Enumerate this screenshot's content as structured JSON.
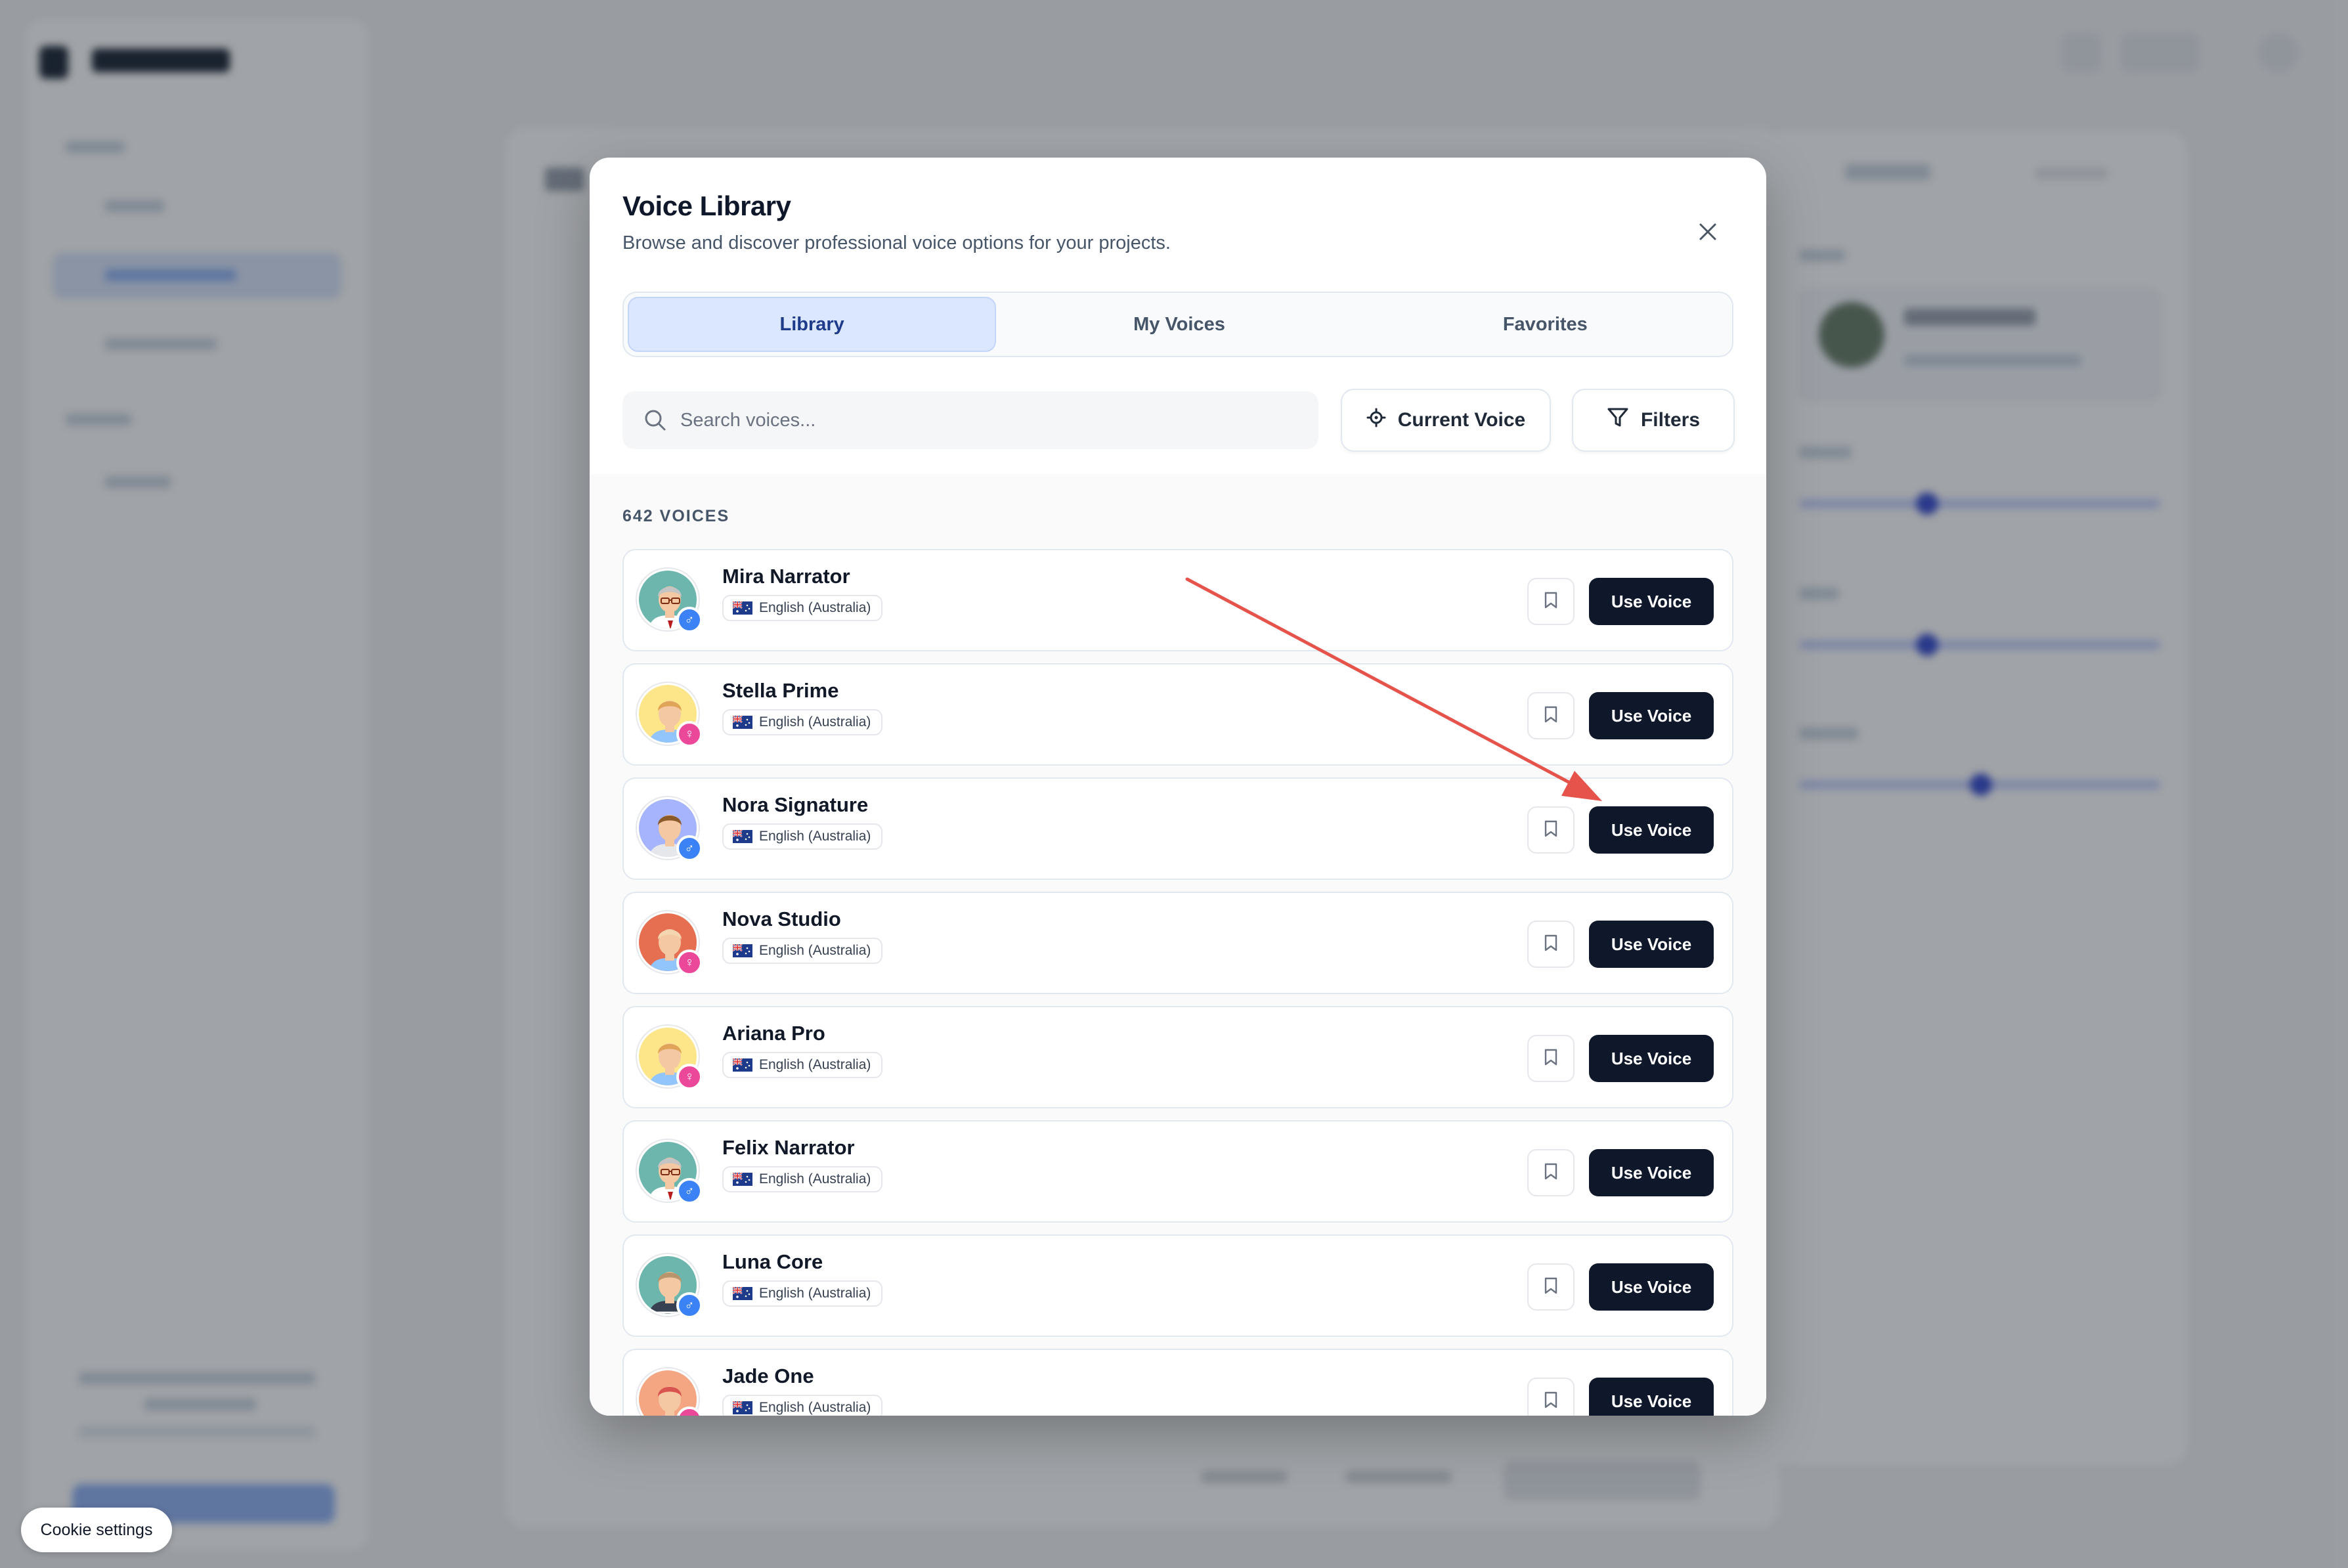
{
  "modal": {
    "title": "Voice Library",
    "subtitle": "Browse and discover professional voice options for your projects."
  },
  "tabs": [
    {
      "label": "Library",
      "active": true
    },
    {
      "label": "My Voices",
      "active": false
    },
    {
      "label": "Favorites",
      "active": false
    }
  ],
  "search": {
    "placeholder": "Search voices...",
    "value": ""
  },
  "toolbar": {
    "current_voice_label": "Current Voice",
    "filters_label": "Filters"
  },
  "voices_count_label": "642 VOICES",
  "voices": [
    {
      "name": "Mira Narrator",
      "language": "English (Australia)",
      "gender": "male",
      "avatar": "man-glasses",
      "button": "Use Voice"
    },
    {
      "name": "Stella Prime",
      "language": "English (Australia)",
      "gender": "female",
      "avatar": "woman-curly",
      "button": "Use Voice"
    },
    {
      "name": "Nora Signature",
      "language": "English (Australia)",
      "gender": "male",
      "avatar": "man-young",
      "button": "Use Voice"
    },
    {
      "name": "Nova Studio",
      "language": "English (Australia)",
      "gender": "female",
      "avatar": "woman-bun",
      "button": "Use Voice"
    },
    {
      "name": "Ariana Pro",
      "language": "English (Australia)",
      "gender": "female",
      "avatar": "woman-curly",
      "button": "Use Voice"
    },
    {
      "name": "Felix Narrator",
      "language": "English (Australia)",
      "gender": "male",
      "avatar": "man-glasses",
      "button": "Use Voice"
    },
    {
      "name": "Luna Core",
      "language": "English (Australia)",
      "gender": "male",
      "avatar": "man-striped",
      "button": "Use Voice"
    },
    {
      "name": "Jade One",
      "language": "English (Australia)",
      "gender": "female",
      "avatar": "woman-red",
      "button": "Use Voice"
    }
  ],
  "cookie": {
    "label": "Cookie settings"
  },
  "colors": {
    "male_badge": "#3b82f6",
    "female_badge": "#ec4899",
    "annotation_arrow": "#e5534b",
    "primary_button": "#0f172a",
    "active_tab_bg": "#dbe7ff"
  }
}
